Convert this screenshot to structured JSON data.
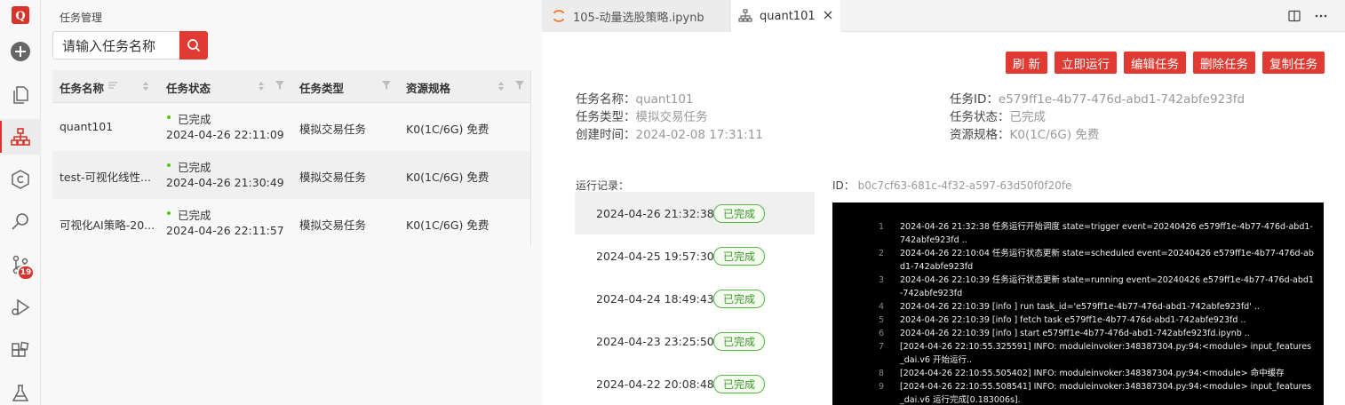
{
  "left_panel": {
    "title": "任务管理",
    "search_placeholder": "请输入任务名称",
    "columns": [
      "任务名称",
      "任务状态",
      "任务类型",
      "资源规格"
    ],
    "rows": [
      {
        "name": "quant101",
        "status": "已完成",
        "time": "2024-04-26 22:11:09",
        "type": "模拟交易任务",
        "spec": "K0(1C/6G) 免费"
      },
      {
        "name": "test-可视化线性...",
        "status": "已完成",
        "time": "2024-04-26 21:30:49",
        "type": "模拟交易任务",
        "spec": "K0(1C/6G) 免费"
      },
      {
        "name": "可视化AI策略-20...",
        "status": "已完成",
        "time": "2024-04-26 22:11:57",
        "type": "模拟交易任务",
        "spec": "K0(1C/6G) 免费"
      }
    ]
  },
  "activity_bar": {
    "items": [
      "logo-icon",
      "add-icon",
      "files-icon",
      "tasks-icon",
      "copyright-icon",
      "search-icon",
      "source-control-icon",
      "run-debug-icon",
      "extensions-icon",
      "flask-icon"
    ],
    "badge": "19",
    "brand_color": "#d9342b"
  },
  "tabs": [
    {
      "label": "105-动量选股策略.ipynb",
      "icon": "jupyter-icon"
    },
    {
      "label": "quant101",
      "icon": "hierarchy-icon"
    }
  ],
  "actions": [
    "刷 新",
    "立即运行",
    "编辑任务",
    "删除任务",
    "复制任务"
  ],
  "details": {
    "name_label": "任务名称：",
    "name": "quant101",
    "type_label": "任务类型：",
    "type": "模拟交易任务",
    "created_label": "创建时间：",
    "created": "2024-02-08 17:31:11",
    "id_label": "任务ID：",
    "id": "e579ff1e-4b77-476d-abd1-742abfe923fd",
    "status_label": "任务状态：",
    "status": "已完成",
    "spec_label": "资源规格：",
    "spec": "K0(1C/6G) 免费"
  },
  "runs": {
    "label": "运行记录：",
    "items": [
      {
        "time": "2024-04-26 21:32:38",
        "status": "已完成"
      },
      {
        "time": "2024-04-25 19:57:30",
        "status": "已完成"
      },
      {
        "time": "2024-04-24 18:49:43",
        "status": "已完成"
      },
      {
        "time": "2024-04-23 23:25:50",
        "status": "已完成"
      },
      {
        "time": "2024-04-22 20:08:48",
        "status": "已完成"
      }
    ]
  },
  "run_id": {
    "label": "ID：",
    "value": "b0c7cf63-681c-4f32-a597-63d50f0f20fe"
  },
  "log": [
    {
      "n": "1",
      "text": "2024-04-26 21:32:38 任务运行开始调度 state=trigger event=20240426 e579ff1e-4b77-476d-abd1-742abfe923fd .."
    },
    {
      "n": "2",
      "text": "2024-04-26 22:10:04 任务运行状态更新 state=scheduled event=20240426 e579ff1e-4b77-476d-abd1-742abfe923fd"
    },
    {
      "n": "3",
      "text": "2024-04-26 22:10:39 任务运行状态更新 state=running event=20240426 e579ff1e-4b77-476d-abd1-742abfe923fd"
    },
    {
      "n": "4",
      "text": "2024-04-26 22:10:39 [info     ] run task_id='e579ff1e-4b77-476d-abd1-742abfe923fd' .."
    },
    {
      "n": "5",
      "text": "2024-04-26 22:10:39 [info     ] fetch task e579ff1e-4b77-476d-abd1-742abfe923fd .."
    },
    {
      "n": "6",
      "text": "2024-04-26 22:10:39 [info     ] start e579ff1e-4b77-476d-abd1-742abfe923fd.ipynb .."
    },
    {
      "n": "7",
      "text": "[2024-04-26 22:10:55.325591] INFO: moduleinvoker:348387304.py:94:<module> input_features_dai.v6 开始运行.."
    },
    {
      "n": "8",
      "text": "[2024-04-26 22:10:55.505402] INFO: moduleinvoker:348387304.py:94:<module> 命中缓存"
    },
    {
      "n": "9",
      "text": "[2024-04-26 22:10:55.508541] INFO: moduleinvoker:348387304.py:94:<module> input_features_dai.v6 运行完成[0.183006s]."
    }
  ]
}
